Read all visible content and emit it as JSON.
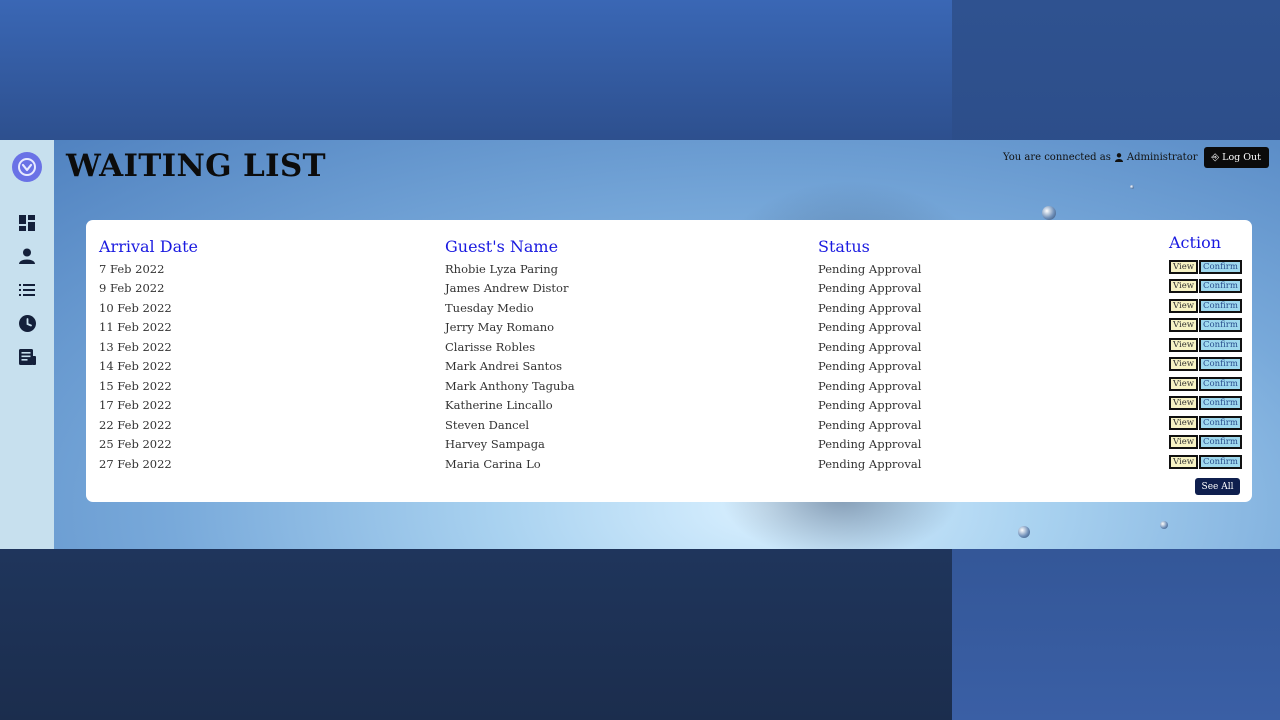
{
  "page": {
    "title": "WAITING LIST"
  },
  "header": {
    "connected_label": "You are connected as",
    "user_name": "Administrator",
    "logout_label": "Log Out"
  },
  "sidebar": {
    "icons": [
      "dashboard-icon",
      "user-icon",
      "list-icon",
      "clock-icon",
      "report-icon"
    ]
  },
  "table": {
    "headers": {
      "arrival": "Arrival Date",
      "guest": "Guest's Name",
      "status": "Status",
      "action": "Action"
    },
    "view_label": "View",
    "confirm_label": "Confirm",
    "rows": [
      {
        "date": "7 Feb 2022",
        "name": "Rhobie Lyza Paring",
        "status": "Pending Approval"
      },
      {
        "date": "9 Feb 2022",
        "name": "James Andrew Distor",
        "status": "Pending Approval"
      },
      {
        "date": "10 Feb 2022",
        "name": "Tuesday Medio",
        "status": "Pending Approval"
      },
      {
        "date": "11 Feb 2022",
        "name": "Jerry May Romano",
        "status": "Pending Approval"
      },
      {
        "date": "13 Feb 2022",
        "name": "Clarisse Robles",
        "status": "Pending Approval"
      },
      {
        "date": "14 Feb 2022",
        "name": "Mark Andrei Santos",
        "status": "Pending Approval"
      },
      {
        "date": "15 Feb 2022",
        "name": "Mark Anthony Taguba",
        "status": "Pending Approval"
      },
      {
        "date": "17 Feb 2022",
        "name": "Katherine Lincallo",
        "status": "Pending Approval"
      },
      {
        "date": "22 Feb 2022",
        "name": "Steven Dancel",
        "status": "Pending Approval"
      },
      {
        "date": "25 Feb 2022",
        "name": "Harvey Sampaga",
        "status": "Pending Approval"
      },
      {
        "date": "27 Feb 2022",
        "name": "Maria Carina Lo",
        "status": "Pending Approval"
      }
    ],
    "see_all_label": "See All"
  },
  "colors": {
    "accent": "#1a1ae0",
    "logo": "#6a72e6",
    "sidebar": "#c7e0ee",
    "see_all": "#0f1f4e"
  }
}
